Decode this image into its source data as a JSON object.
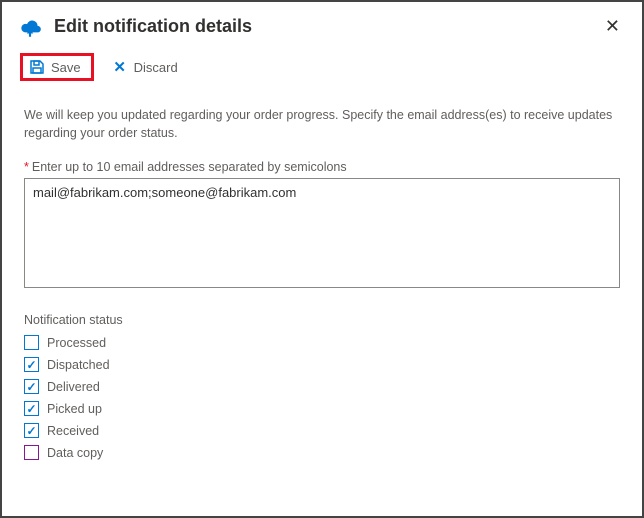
{
  "header": {
    "title": "Edit notification details"
  },
  "toolbar": {
    "save_label": "Save",
    "discard_label": "Discard"
  },
  "description": "We will keep you updated regarding your order progress. Specify the email address(es) to receive updates regarding your order status.",
  "email_field": {
    "label": "Enter up to 10 email addresses separated by semicolons",
    "value": "mail@fabrikam.com;someone@fabrikam.com"
  },
  "status": {
    "title": "Notification status",
    "items": [
      {
        "label": "Processed",
        "checked": false,
        "variant": "blue"
      },
      {
        "label": "Dispatched",
        "checked": true,
        "variant": "blue"
      },
      {
        "label": "Delivered",
        "checked": true,
        "variant": "blue"
      },
      {
        "label": "Picked up",
        "checked": true,
        "variant": "blue"
      },
      {
        "label": "Received",
        "checked": true,
        "variant": "blue"
      },
      {
        "label": "Data copy",
        "checked": false,
        "variant": "purple"
      }
    ]
  },
  "icons": {
    "close": "✕",
    "discard": "✕",
    "check": "✓"
  }
}
